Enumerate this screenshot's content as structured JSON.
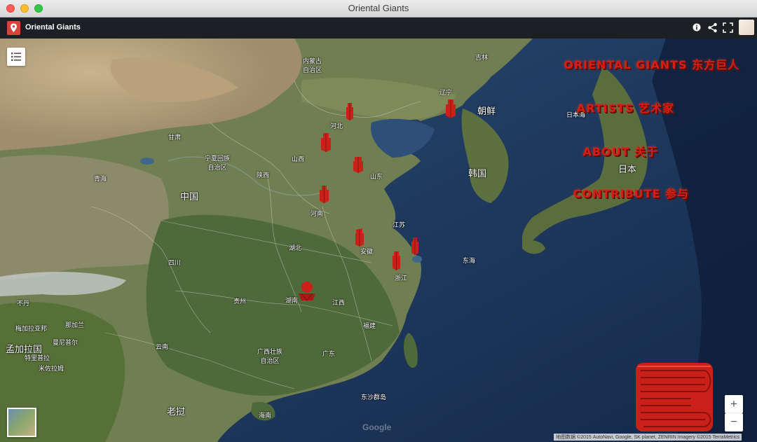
{
  "window": {
    "title": "Oriental Giants"
  },
  "appbar": {
    "title": "Oriental Giants",
    "icons": [
      "map-pin-icon",
      "info-icon",
      "share-icon",
      "fullscreen-icon"
    ]
  },
  "menu": [
    {
      "label": "Oriental Giants 东方巨人"
    },
    {
      "label": "Artists 艺术家"
    },
    {
      "label": "About 关于"
    },
    {
      "label": "Contribute 参与"
    }
  ],
  "map_labels": [
    {
      "text": "内蒙古\n自治区"
    },
    {
      "text": "吉林"
    },
    {
      "text": "辽宁"
    },
    {
      "text": "朝鲜"
    },
    {
      "text": "日本海"
    },
    {
      "text": "日本"
    },
    {
      "text": "韩国"
    },
    {
      "text": "河北"
    },
    {
      "text": "甘肃"
    },
    {
      "text": "宁夏回族\n自治区"
    },
    {
      "text": "山西"
    },
    {
      "text": "陕西"
    },
    {
      "text": "山东"
    },
    {
      "text": "青海"
    },
    {
      "text": "中国"
    },
    {
      "text": "河南"
    },
    {
      "text": "江苏"
    },
    {
      "text": "湖北"
    },
    {
      "text": "安徽"
    },
    {
      "text": "四川"
    },
    {
      "text": "东海"
    },
    {
      "text": "浙江"
    },
    {
      "text": "贵州"
    },
    {
      "text": "湖南"
    },
    {
      "text": "江西"
    },
    {
      "text": "不丹"
    },
    {
      "text": "福建"
    },
    {
      "text": "梅加拉亚邦"
    },
    {
      "text": "那加兰"
    },
    {
      "text": "曼尼普尔"
    },
    {
      "text": "孟加拉国"
    },
    {
      "text": "云南"
    },
    {
      "text": "广西壮族\n自治区"
    },
    {
      "text": "广东"
    },
    {
      "text": "特里普拉"
    },
    {
      "text": "米佐拉姆"
    },
    {
      "text": "东沙群岛"
    },
    {
      "text": "老挝"
    },
    {
      "text": "海南"
    }
  ],
  "controls": {
    "zoom_in": "+",
    "zoom_out": "−"
  },
  "attribution": "地图数据 ©2015 AutoNavi, Google, SK planet, ZENRIN Imagery ©2015 TerraMetrics",
  "google": "Google",
  "colors": {
    "accent": "#d32015",
    "marker": "#c9201a",
    "ocean": "#1d3556"
  }
}
